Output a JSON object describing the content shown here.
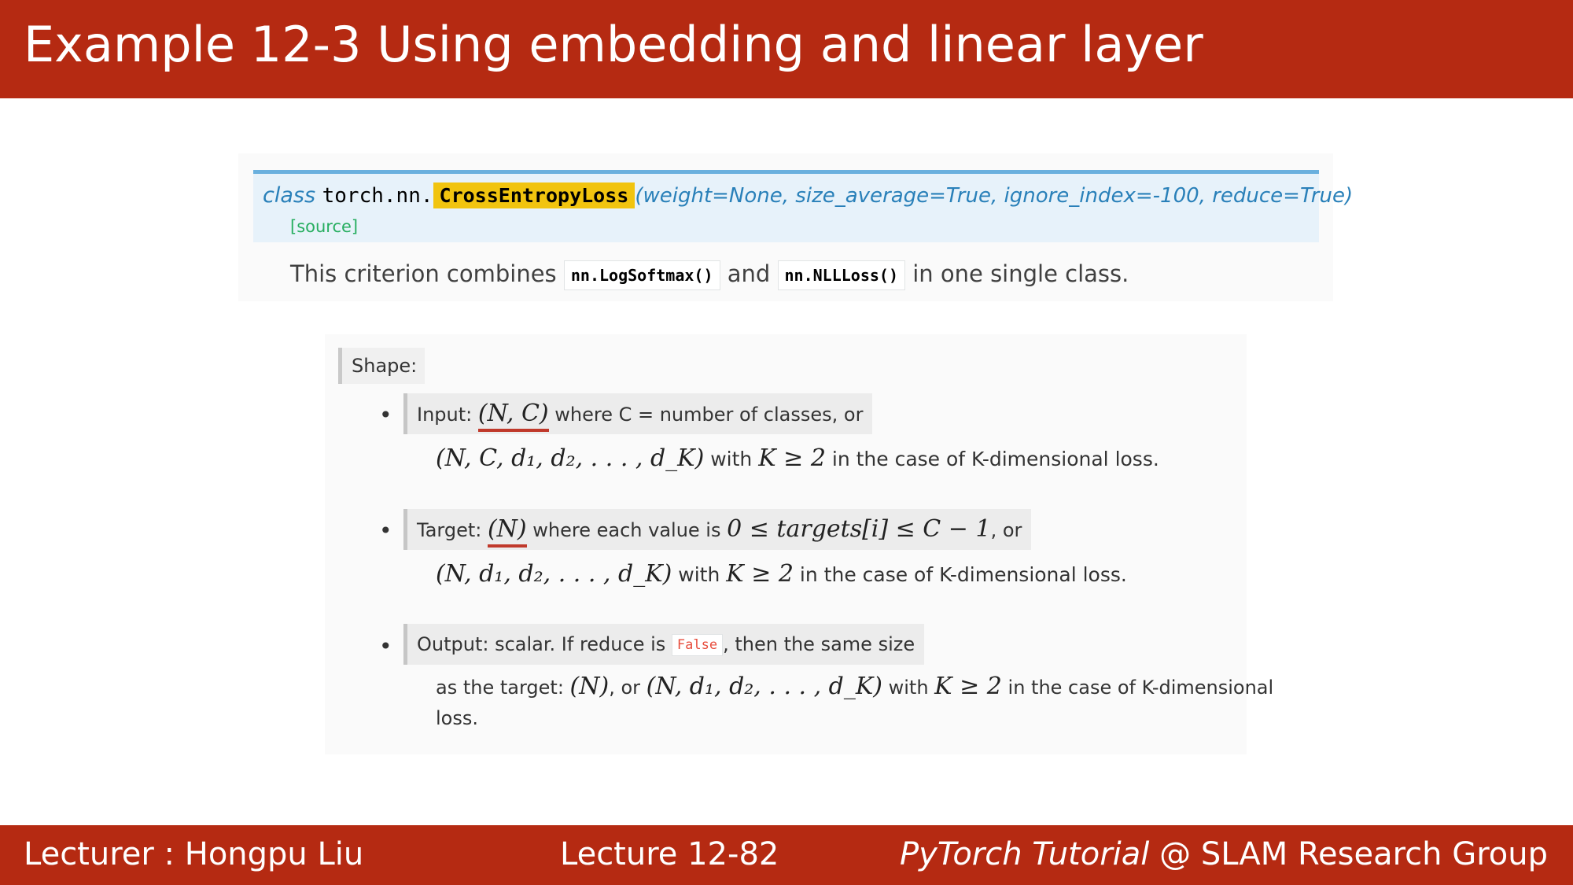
{
  "header": {
    "title": "Example 12-3 Using embedding and linear layer"
  },
  "doc": {
    "keyword": "class",
    "module": "torch.nn.",
    "class_name": "CrossEntropyLoss",
    "params": "(weight=None, size_average=True, ignore_index=-100, reduce=True)",
    "source_link": "[source]",
    "desc_part1": "This criterion combines",
    "code1": "nn.LogSoftmax()",
    "desc_and": "and",
    "code2": "nn.NLLLoss()",
    "desc_part2": "in one single class."
  },
  "shape": {
    "label": "Shape:",
    "items": [
      {
        "bullet": "•",
        "head_pre": "Input: ",
        "head_math": "(N, C)",
        "head_post": " where C = number of classes, or",
        "cont_math": "(N, C, d₁, d₂, . . . , d_K)",
        "cont_with": " with ",
        "cont_math2": "K ≥ 2",
        "cont_post": " in the case of K-dimensional loss."
      },
      {
        "bullet": "•",
        "head_pre": "Target: ",
        "head_math": "(N)",
        "head_mid": " where each value is ",
        "head_math2": "0 ≤ targets[i] ≤ C − 1",
        "head_post": ", or",
        "cont_math": "(N, d₁, d₂, . . . , d_K)",
        "cont_with": " with ",
        "cont_math2": "K ≥ 2",
        "cont_post": " in the case of K-dimensional loss."
      },
      {
        "bullet": "•",
        "head_pre": "Output: scalar. If reduce is ",
        "head_code": "False",
        "head_post": ", then the same size",
        "cont_pre": "as the target: ",
        "cont_math": "(N)",
        "cont_mid": ", or ",
        "cont_math2": "(N, d₁, d₂, . . . , d_K)",
        "cont_with": " with ",
        "cont_math3": "K ≥ 2",
        "cont_post": " in the case of K-dimensional",
        "cont_line2": "loss."
      }
    ]
  },
  "footer": {
    "left": "Lecturer : Hongpu Liu",
    "center": "Lecture 12-82",
    "right_italic": "PyTorch Tutorial",
    "right_rest": " @ SLAM Research Group"
  },
  "colors": {
    "brand": "#b52a12",
    "link": "#2980b9",
    "highlight": "#f1c40f",
    "source": "#27ae60"
  }
}
